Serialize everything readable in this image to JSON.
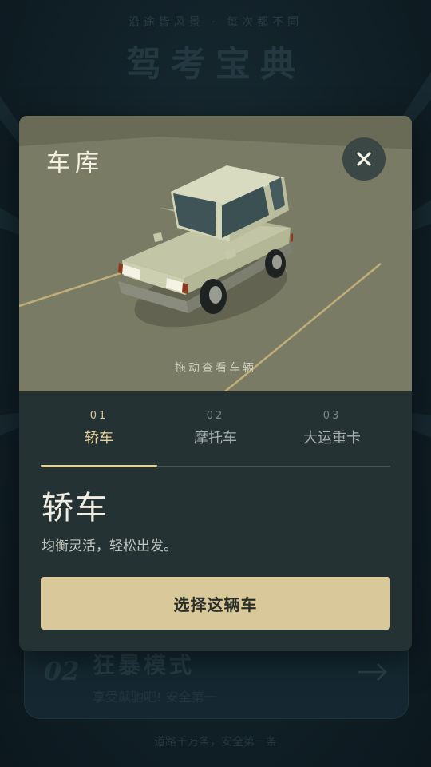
{
  "background": {
    "tagline": "沿途皆风景 · 每次都不同",
    "title": "驾考宝典",
    "mode_card": {
      "number": "02",
      "title": "狂暴模式",
      "subtitle": "享受飙驰吧! 安全第一"
    },
    "footer": "道路千万条，安全第一条"
  },
  "garage": {
    "title": "车库",
    "close_icon": "close-icon",
    "drag_hint": "拖动查看车辆",
    "tabs": [
      {
        "num": "01",
        "label": "轿车",
        "active": true
      },
      {
        "num": "02",
        "label": "摩托车",
        "active": false
      },
      {
        "num": "03",
        "label": "大运重卡",
        "active": false
      }
    ],
    "selected": {
      "name": "轿车",
      "description": "均衡灵活，轻松出发。"
    },
    "select_button": "选择这辆车"
  },
  "colors": {
    "accent": "#d9c899",
    "modal_bg": "#243234",
    "scene_bg": "#7a7b65",
    "page_bg": "#12222a"
  }
}
